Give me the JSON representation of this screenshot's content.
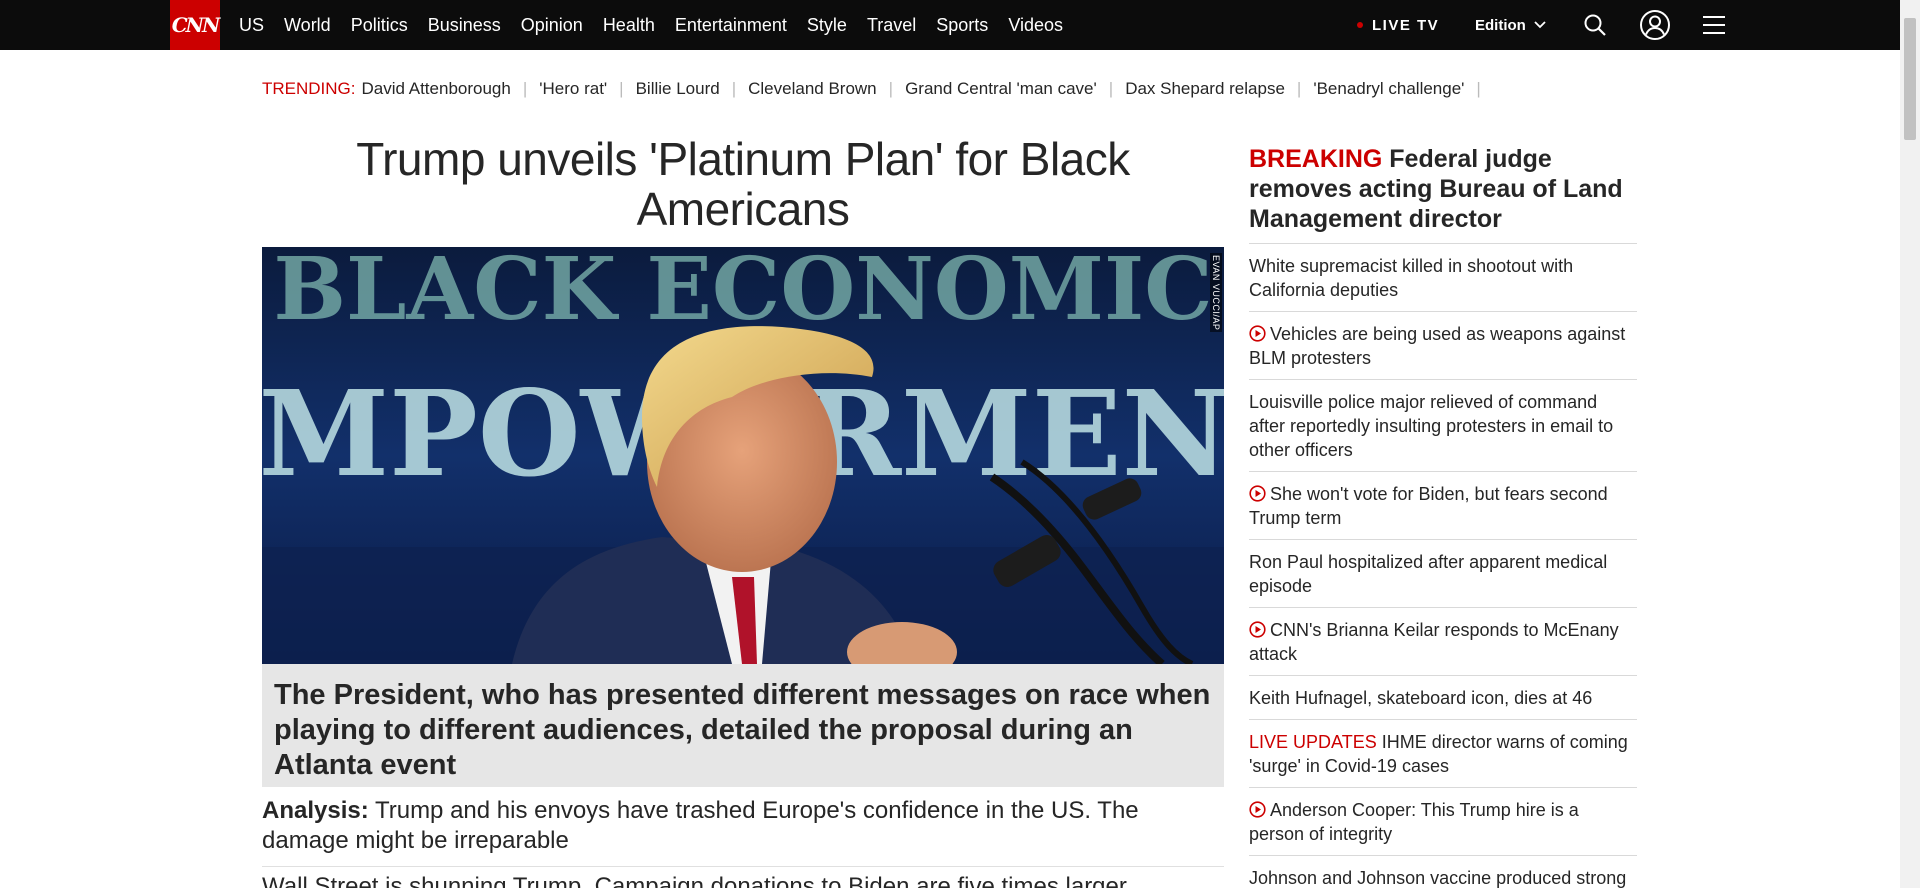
{
  "nav": {
    "logo": "CNN",
    "links": [
      "US",
      "World",
      "Politics",
      "Business",
      "Opinion",
      "Health",
      "Entertainment",
      "Style",
      "Travel",
      "Sports",
      "Videos"
    ],
    "live_tv": "LIVE TV",
    "edition": "Edition"
  },
  "trending": {
    "label": "TRENDING:",
    "items": [
      "David Attenborough",
      "'Hero rat'",
      "Billie Lourd",
      "Cleveland Brown",
      "Grand Central 'man cave'",
      "Dax Shepard relapse",
      "'Benadryl challenge'"
    ]
  },
  "main": {
    "headline": "Trump unveils 'Platinum Plan' for Black Americans",
    "photo_credit": "EVAN VUCCI/AP",
    "hero_sign_top": "BLACK ECONOMIC",
    "hero_sign_mid": "EMPOWERMENT",
    "caption": "The President, who has presented different messages on race when playing to different audiences, detailed the proposal during an Atlanta event",
    "analysis_label": "Analysis:",
    "analysis_text": " Trump and his envoys have trashed Europe's confidence in the US. The damage might be irreparable",
    "next_story": "Wall Street is shunning Trump. Campaign donations to Biden are five times larger"
  },
  "sidebar": {
    "breaking_tag": "BREAKING",
    "breaking_text": " Federal judge removes acting Bureau of Land Management director",
    "items": [
      {
        "text": "White supremacist killed in shootout with California deputies"
      },
      {
        "text": "Vehicles are being used as weapons against BLM protesters"
      },
      {
        "text": "Louisville police major relieved of command after reportedly insulting protesters in email to other officers"
      },
      {
        "text": "She won't vote for Biden, but fears second Trump term"
      },
      {
        "text": "Ron Paul hospitalized after apparent medical episode"
      },
      {
        "text": "CNN's Brianna Keilar responds to McEnany attack"
      },
      {
        "text": "Keith Hufnagel, skateboard icon, dies at 46"
      },
      {
        "text": "IHME director warns of coming 'surge' in Covid-19 cases",
        "tag": "LIVE UPDATES"
      },
      {
        "text": "Anderson Cooper: This Trump hire is a person of integrity"
      },
      {
        "text": "Johnson and Johnson vaccine produced strong immune response, early results say"
      }
    ]
  },
  "icons": [
    "search-icon",
    "account-icon",
    "menu-icon",
    "play-icon",
    "chevron-down-icon"
  ],
  "colors": {
    "brand": "#cc0000",
    "nav_bg": "#0c0c0c",
    "caption_bg": "#e6e6e6"
  }
}
